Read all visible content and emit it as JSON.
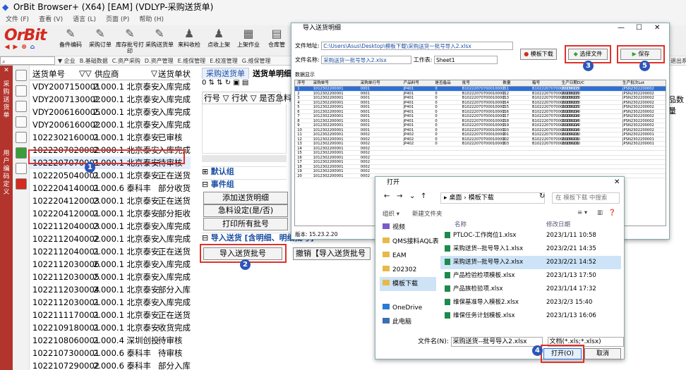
{
  "app": {
    "title": "OrBit Browser+ (X64) [EAM] (VDLYP-采购送货单)"
  },
  "menu": [
    "文件 (F)",
    "查看 (V)",
    "语言 (L)",
    "页面 (P)",
    "帮助 (H)"
  ],
  "brand": "OrBit",
  "toolbar": [
    "备件编码",
    "采购订单",
    "库存批号打印",
    "采购送货单",
    "来料收检",
    "点收上架",
    "上架作业",
    "仓库管"
  ],
  "modules": {
    "search": "",
    "tabs": [
      "▼ 企业",
      "B.基础数据",
      "C.资产采购",
      "D.资产管理",
      "E.维保管理",
      "E.校准管理",
      "G.维保管理"
    ],
    "extra": "退出系"
  },
  "left_vertical": [
    "采购送货单",
    "用户编码定义"
  ],
  "list": {
    "headers": {
      "col1": "送货单号",
      "col2": "供应商",
      "col3": "送货单状"
    },
    "rows": [
      {
        "no": "VDY2007150001",
        "vendor": "2.000.1 北京泰安",
        "status": "入库完成"
      },
      {
        "no": "VDY2007130002",
        "vendor": "2.000.1 北京泰安",
        "status": "入库完成"
      },
      {
        "no": "VDY2006160005",
        "vendor": "2.000.1 北京泰安",
        "status": "入库完成"
      },
      {
        "no": "VDY2006160002",
        "vendor": "2.000.1 北京泰安",
        "status": "入库完成"
      },
      {
        "no": "102230216000​1",
        "vendor": "2.000.1 北京泰安",
        "status": "已审核"
      },
      {
        "no": "1022207020002",
        "vendor": "2.000.1 北京泰安",
        "status": "入库完成"
      },
      {
        "no": "1022207070001",
        "vendor": "2.000.1 北京泰安",
        "status": "待审核"
      },
      {
        "no": "1022205040001",
        "vendor": "2.000.1 北京泰安",
        "status": "正在送货"
      },
      {
        "no": "1022204140001",
        "vendor": "2.000.6 泰科丰",
        "status": "部分收货"
      },
      {
        "no": "1022204120003",
        "vendor": "2.000.1 北京泰安",
        "status": "正在送货"
      },
      {
        "no": "1022204120001",
        "vendor": "2.000.1 北京泰安",
        "status": "部分拒收"
      },
      {
        "no": "1022112040003",
        "vendor": "2.000.1 北京泰安",
        "status": "入库完成"
      },
      {
        "no": "1022112040002",
        "vendor": "2.000.1 北京泰安",
        "status": "入库完成"
      },
      {
        "no": "1022112040001",
        "vendor": "2.000.1 北京泰安",
        "status": "正在送货"
      },
      {
        "no": "1022112030006",
        "vendor": "2.000.1 北京泰安",
        "status": "入库完成"
      },
      {
        "no": "1022112030005",
        "vendor": "2.000.1 北京泰安",
        "status": "入库完成"
      },
      {
        "no": "1022112030004",
        "vendor": "2.000.1 北京泰安",
        "status": "部分入库"
      },
      {
        "no": "1022112030001",
        "vendor": "2.000.1 北京泰安",
        "status": "入库完成"
      },
      {
        "no": "1022111170001",
        "vendor": "2.000.1 北京泰安",
        "status": "正在送货"
      },
      {
        "no": "1022109180001",
        "vendor": "2.000.1 北京泰安",
        "status": "收货完成"
      },
      {
        "no": "1022108060001",
        "vendor": "2.000.4 深圳创投",
        "status": "待审核"
      },
      {
        "no": "1022107300001",
        "vendor": "2.000.6 泰科丰",
        "status": "待审核"
      },
      {
        "no": "1022107290002",
        "vendor": "2.000.6 泰科丰",
        "status": "部分入库"
      },
      {
        "no": "1022107290001",
        "vendor": "2.000.1 北京泰安",
        "status": "入库完成"
      }
    ]
  },
  "center": {
    "tabs": [
      "采购送货单",
      "送货单明细"
    ],
    "grid_header": "行号 ▽ 行状 ▽ 是否急料",
    "sections": {
      "default": "默认组",
      "events": "事件组",
      "import": "导入送货 [含明细、明细批号]"
    },
    "buttons": {
      "add_detail": "添加送货明细",
      "urgent": "急料设定(是/否)",
      "print_batch": "打印所有批号",
      "import_batch": "导入送货批号",
      "cancel_import": "撤销【导入送货批号"
    }
  },
  "right_edge": "品数量",
  "import_win": {
    "title": "导入送货明细",
    "file_label": "文件地址:",
    "file_value": "C:\\Users\\Asus\\Desktop\\模板下载\\采购送货一批号导入2.xlsx",
    "name_label": "文件名称:",
    "name_value": "采购送货一批号导入2.xlsx",
    "sheet_label": "工作表:",
    "sheet_value": "Sheet1",
    "btn_template": "模板下载",
    "btn_choose": "选择文件",
    "btn_save": "保存",
    "data_label": "数据显示",
    "version": "版本: 15.23.2.20",
    "grid_headers": [
      "序号",
      "采购单号",
      "采购单行号",
      "产品料号",
      "是否备品",
      "批号",
      "数量",
      "箱号",
      "生产日期D/C",
      "生产批次Lot",
      "MPN"
    ],
    "grid_rows": [
      [
        "1",
        "1012302200001",
        "0001",
        "JP401",
        "0",
        "B1022207070001000011",
        "2",
        "B1022207070001000003",
        "20230220",
        "JPSN2302200002",
        ""
      ],
      [
        "2",
        "1012302200001",
        "0001",
        "JP401",
        "0",
        "B1022207070001000012",
        "2",
        "B1022207070001000003",
        "20230220",
        "JPSN2302200002",
        ""
      ],
      [
        "3",
        "1012302200001",
        "0001",
        "JP401",
        "0",
        "B1022207070001000013",
        "2",
        "B1022207070001000003",
        "20230220",
        "JPSN2302200002",
        ""
      ],
      [
        "4",
        "1012302200001",
        "0001",
        "JP401",
        "0",
        "B1022207070001000014",
        "2",
        "B1022207070001000003",
        "20230220",
        "JPSN2302200002",
        ""
      ],
      [
        "5",
        "1012302200001",
        "0001",
        "JP401",
        "0",
        "B1022207070001000015",
        "2",
        "B1022207070001000003",
        "20230220",
        "JPSN2302200002",
        ""
      ],
      [
        "6",
        "1012302200001",
        "0001",
        "JP401",
        "0",
        "B1022207070001000016",
        "2",
        "B1022207070001000004",
        "20230220",
        "JPSN2302200002",
        ""
      ],
      [
        "7",
        "1012302200001",
        "0001",
        "JP401",
        "0",
        "B1022207070001000017",
        "2",
        "B1022207070001000004",
        "20230220",
        "JPSN2302200002",
        ""
      ],
      [
        "8",
        "1012302200001",
        "0001",
        "JP401",
        "0",
        "B1022207070001000018",
        "2",
        "B1022207070001000004",
        "20230220",
        "JPSN2302200002",
        ""
      ],
      [
        "9",
        "1012302200001",
        "0001",
        "JP401",
        "0",
        "B1022207070001000019",
        "2",
        "B1022207070001000004",
        "20230220",
        "JPSN2302200002",
        ""
      ],
      [
        "10",
        "1012302200001",
        "0001",
        "JP401",
        "0",
        "B1022207070001000020",
        "2",
        "B1022207070001000004",
        "20230220",
        "JPSN2302200002",
        ""
      ],
      [
        "11",
        "1012302200001",
        "0002",
        "JP402",
        "0",
        "B1022207070001000001",
        "2",
        "B1022207070001000001",
        "20230220",
        "JPSN2302200001",
        ""
      ],
      [
        "12",
        "1012302200001",
        "0002",
        "JP402",
        "0",
        "B1022207070001000002",
        "2",
        "B1022207070001000001",
        "20230220",
        "JPSN2302200001",
        ""
      ],
      [
        "13",
        "1012302200001",
        "0002",
        "JP402",
        "0",
        "B1022207070001000003",
        "2",
        "B1022207070001000001",
        "20230220",
        "JPSN2302200001",
        ""
      ],
      [
        "14",
        "1012302200001",
        "0002",
        "",
        "",
        "",
        "",
        "",
        "",
        "",
        ""
      ],
      [
        "15",
        "1012302200001",
        "0002",
        "",
        "",
        "",
        "",
        "",
        "",
        "",
        ""
      ],
      [
        "16",
        "1012302200001",
        "0002",
        "",
        "",
        "",
        "",
        "",
        "",
        "",
        ""
      ],
      [
        "17",
        "1012302200001",
        "0002",
        "",
        "",
        "",
        "",
        "",
        "",
        "",
        ""
      ],
      [
        "18",
        "1012302200001",
        "0002",
        "",
        "",
        "",
        "",
        "",
        "",
        "",
        ""
      ],
      [
        "19",
        "1012302200001",
        "0002",
        "",
        "",
        "",
        "",
        "",
        "",
        "",
        ""
      ],
      [
        "20",
        "1012302200001",
        "0002",
        "",
        "",
        "",
        "",
        "",
        "",
        "",
        ""
      ]
    ]
  },
  "open_dialog": {
    "title": "打开",
    "path": "▸ 桌面 › 模板下载",
    "search": "在 模板下载 中搜索",
    "organize": "组织 ▾",
    "new_folder": "新建文件夹",
    "sidebar": [
      "视频",
      "QMS接料AQL表",
      "EAM",
      "202302",
      "模板下载",
      "OneDrive",
      "此电脑"
    ],
    "col_name": "名称",
    "col_date": "修改日期",
    "files": [
      {
        "name": "PTLOC-工作岗位1.xlsx",
        "date": "2023/1/11 10:58"
      },
      {
        "name": "采购送货--批号导入1.xlsx",
        "date": "2023/2/21 14:35"
      },
      {
        "name": "采购送货--批号导入2.xlsx",
        "date": "2023/2/21 14:52"
      },
      {
        "name": "产品检验检项模板.xlsx",
        "date": "2023/1/13 17:50"
      },
      {
        "name": "产品族检验项.xlsx",
        "date": "2023/1/14 17:32"
      },
      {
        "name": "维保基准导入模板2.xlsx",
        "date": "2023/2/3 15:40"
      },
      {
        "name": "维保任务计划模板.xlsx",
        "date": "2023/1/13 16:06"
      }
    ],
    "filename_label": "文件名(N):",
    "filename_value": "采购送货--批号导入2.xlsx",
    "filter": "文档(*.xls;*.xlsx)",
    "open_btn": "打开(O)",
    "cancel_btn": "取消"
  },
  "badges": [
    "1",
    "2",
    "3",
    "4",
    "5"
  ]
}
